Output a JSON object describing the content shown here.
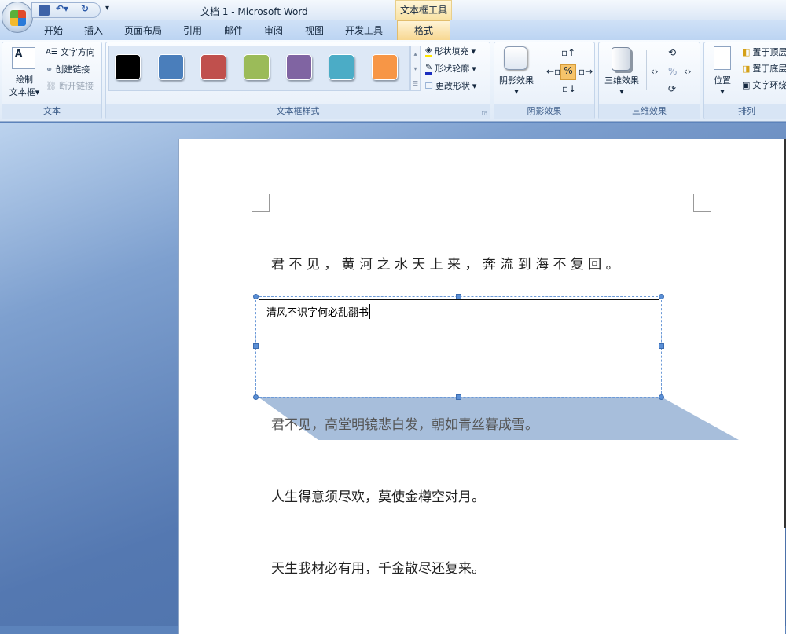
{
  "window": {
    "title": "文档 1 - Microsoft Word",
    "context_tab_group": "文本框工具"
  },
  "tabs": [
    "开始",
    "插入",
    "页面布局",
    "引用",
    "邮件",
    "审阅",
    "视图",
    "开发工具",
    "格式"
  ],
  "active_tab": "格式",
  "ribbon": {
    "text_group": {
      "label": "文本",
      "draw_textbox": "绘制",
      "draw_textbox2": "文本框",
      "text_direction": "文字方向",
      "create_link": "创建链接",
      "break_link": "断开链接"
    },
    "styles_group": {
      "label": "文本框样式",
      "swatches": [
        "#000000",
        "#4a7ebb",
        "#c0504d",
        "#9bbb59",
        "#8064a2",
        "#4bacc6",
        "#f79646"
      ],
      "shape_fill": "形状填充",
      "shape_outline": "形状轮廓",
      "change_shape": "更改形状"
    },
    "shadow_group": {
      "label": "阴影效果",
      "button": "阴影效果"
    },
    "threed_group": {
      "label": "三维效果",
      "button": "三维效果"
    },
    "arrange_group": {
      "label": "排列",
      "position": "位置",
      "bring_front": "置于顶层",
      "send_back": "置于底层",
      "text_wrap": "文字环绕"
    }
  },
  "document": {
    "line1": "君 不 见 ， 黄 河 之 水 天 上 来 ， 奔 流 到 海 不 复 回 。",
    "textbox_text": "清风不识字何必乱翻书",
    "line2": "君不见，高堂明镜悲白发，朝如青丝暮成雪。",
    "line3": "人生得意须尽欢，莫使金樽空对月。",
    "line4": "天生我材必有用，千金散尽还复来。",
    "shadow_color": "#a7bedb"
  }
}
